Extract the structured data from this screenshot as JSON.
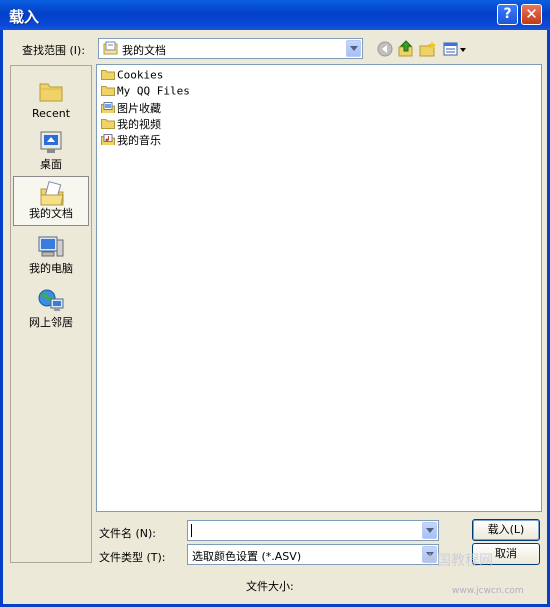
{
  "window": {
    "title": "载入",
    "help_label": "?",
    "close_label": "✕"
  },
  "lookin": {
    "label": "查找范围 (I):",
    "value": "我的文档"
  },
  "toolbar": {
    "icons": [
      "back-icon",
      "up-folder-icon",
      "new-folder-icon",
      "view-menu-icon"
    ]
  },
  "places": [
    {
      "label": "Recent",
      "icon": "recent-folder-icon"
    },
    {
      "label": "桌面",
      "icon": "desktop-icon"
    },
    {
      "label": "我的文档",
      "icon": "my-documents-icon",
      "selected": true
    },
    {
      "label": "我的电脑",
      "icon": "my-computer-icon"
    },
    {
      "label": "网上邻居",
      "icon": "network-icon"
    }
  ],
  "files": [
    {
      "name": "Cookies",
      "icon": "folder-icon"
    },
    {
      "name": "My QQ Files",
      "icon": "folder-icon"
    },
    {
      "name": "图片收藏",
      "icon": "pictures-folder-icon"
    },
    {
      "name": "我的视频",
      "icon": "folder-icon"
    },
    {
      "name": "我的音乐",
      "icon": "music-folder-icon"
    }
  ],
  "filename": {
    "label": "文件名 (N):",
    "value": ""
  },
  "filetype": {
    "label": "文件类型 (T):",
    "value": "选取颜色设置 (*.ASV)"
  },
  "buttons": {
    "load": "载入(L)",
    "cancel": "取消"
  },
  "filesize": {
    "label": "文件大小:"
  },
  "watermark": {
    "text": "中国教程网",
    "url": "www.jcwcn.com"
  },
  "colors": {
    "titlebar": "#0a4ad8",
    "dialog_bg": "#ece9d8",
    "border": "#7f9db9"
  }
}
